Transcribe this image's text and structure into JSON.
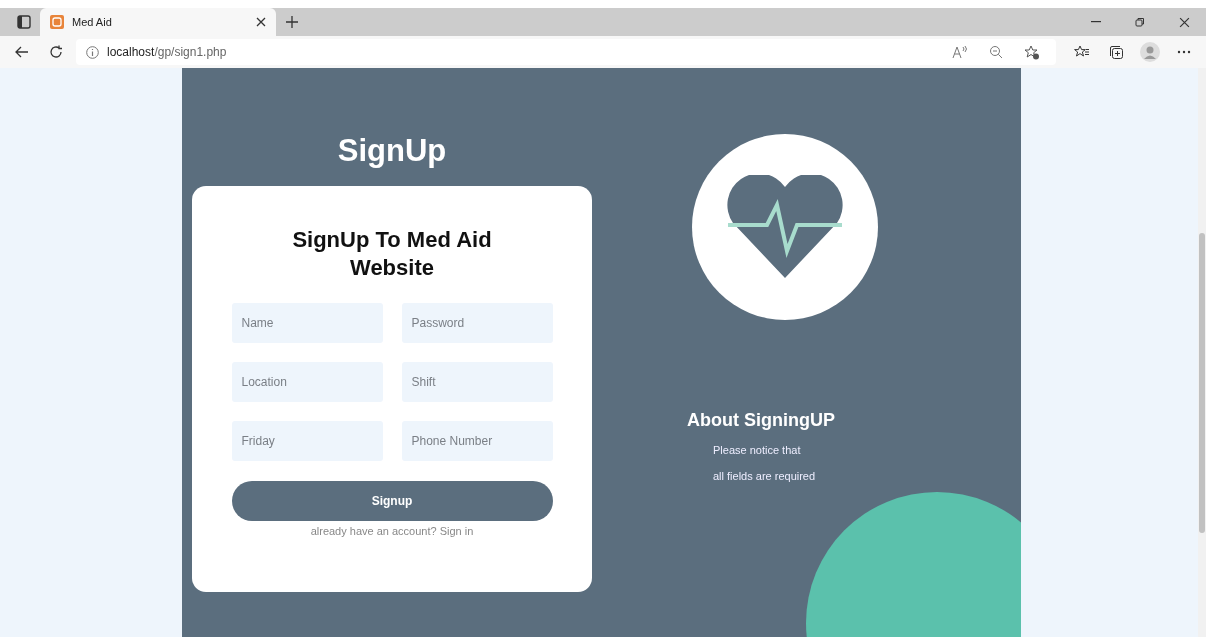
{
  "browser": {
    "tab": {
      "title": "Med Aid"
    },
    "address": {
      "host": "localhost",
      "path": "/gp/sign1.php"
    }
  },
  "page": {
    "title": "SignUp",
    "form": {
      "heading": "SignUp To Med Aid Website",
      "fields": [
        {
          "placeholder": "Name"
        },
        {
          "placeholder": "Password"
        },
        {
          "placeholder": "Location"
        },
        {
          "placeholder": "Shift"
        },
        {
          "placeholder": "Friday"
        },
        {
          "placeholder": "Phone Number"
        }
      ],
      "submit": "Signup",
      "signin_text": "already have an account? Sign in"
    },
    "about": {
      "heading": "About SigningUP",
      "lines": [
        "Please notice that",
        "all fields are required"
      ]
    }
  }
}
